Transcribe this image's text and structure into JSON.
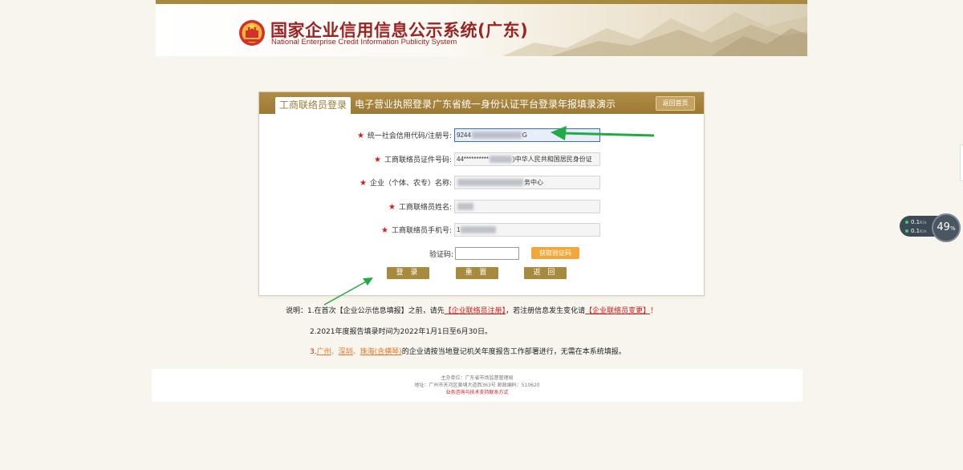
{
  "header": {
    "title": "国家企业信用信息公示系统(广东)",
    "subtitle": "National Enterprise Credit Information Publicity System"
  },
  "tabs": [
    {
      "label": "工商联络员登录",
      "active": true
    },
    {
      "label": "电子营业执照登录",
      "active": false
    },
    {
      "label": "广东省统一身份认证平台登录",
      "active": false
    },
    {
      "label": "年报填录演示",
      "active": false
    }
  ],
  "return_home_label": "返回首页",
  "form": {
    "credit_code": {
      "label": "统一社会信用代码/注册号:",
      "value_start": "9244",
      "value_end": "G"
    },
    "id_number": {
      "label": "工商联络员证件号码:",
      "value_start": "44**********",
      "value_end": ")中华人民共和国居民身份证"
    },
    "company_name": {
      "label": "企业（个体、农专）名称:",
      "value_end": "务中心"
    },
    "contact_name": {
      "label": "工商联络员姓名:"
    },
    "contact_phone": {
      "label": "工商联络员手机号:",
      "value_start": "1"
    },
    "captcha": {
      "label": "验证码:",
      "value": ""
    },
    "get_code_label": "获取验证码"
  },
  "buttons": {
    "login": "登 录",
    "reset": "重 置",
    "back": "返 回"
  },
  "notes": {
    "n1_prefix": "说明：1.在首次【企业公示信息填报】之前，请先",
    "n1_link1": "【企业联络员注册】",
    "n1_mid": "，若注册信息发生变化请",
    "n1_link2": "【企业联络员变更】",
    "n1_end": "！",
    "n2": "2.2021年度报告填录时间为2022年1月1日至6月30日。",
    "n3_prefix": "3.",
    "n3_city1": "广州",
    "n3_sep1": "、",
    "n3_city2": "深圳",
    "n3_sep2": "、",
    "n3_city3": "珠海(含横琴)",
    "n3_end": "的企业请按当地登记机关年度报告工作部署进行，无需在本系统填报。"
  },
  "footer": {
    "sponsor": "主办单位：广东省市场监督管理局",
    "address": "地址：广州市天河区黄埔大道西363号    邮政编码：510620",
    "contact_link": "业务咨询与技术支持联系方式"
  },
  "net_widget": {
    "up": "0.1",
    "down": "0.1",
    "unit": "K/s",
    "percent": "49",
    "percent_sign": "%"
  },
  "colors": {
    "accent": "#a88a3e",
    "title_red": "#9b2323",
    "required_red": "#d21d1d",
    "orange": "#f3a73a",
    "annotation_green": "#22aa44"
  }
}
